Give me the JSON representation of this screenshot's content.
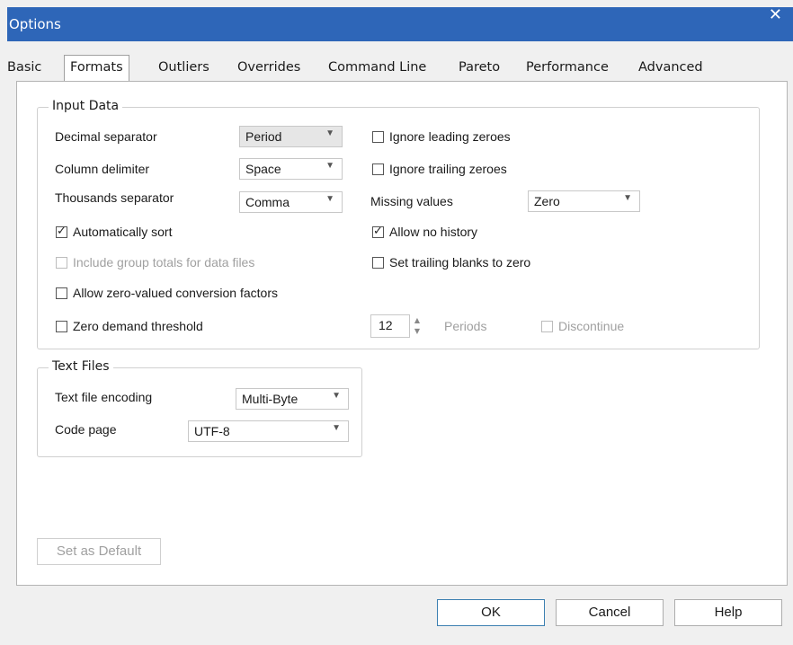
{
  "window": {
    "title": "Options",
    "close_glyph": "✕"
  },
  "tabs": [
    "Basic",
    "Formats",
    "Outliers",
    "Overrides",
    "Command Line",
    "Pareto",
    "Performance",
    "Advanced"
  ],
  "active_tab": "Formats",
  "input_data": {
    "legend": "Input Data",
    "decimal_separator": {
      "label": "Decimal separator",
      "value": "Period"
    },
    "column_delimiter": {
      "label": "Column delimiter",
      "value": "Space"
    },
    "thousands_separator": {
      "label": "Thousands separator",
      "value": "Comma"
    },
    "auto_sort": {
      "label": "Automatically sort",
      "checked": true
    },
    "include_group_totals": {
      "label": "Include group totals for data files",
      "checked": false,
      "disabled": true
    },
    "allow_zero_conversion": {
      "label": "Allow zero-valued conversion factors",
      "checked": false
    },
    "zero_demand": {
      "label": "Zero demand threshold",
      "checked": false
    },
    "ignore_leading": {
      "label": "Ignore leading zeroes",
      "checked": false
    },
    "ignore_trailing": {
      "label": "Ignore trailing zeroes",
      "checked": false
    },
    "missing_values": {
      "label": "Missing values",
      "value": "Zero"
    },
    "allow_no_history": {
      "label": "Allow no history",
      "checked": true
    },
    "set_trailing_blanks": {
      "label": "Set trailing blanks to zero",
      "checked": false
    },
    "periods": {
      "value": "12",
      "label": "Periods"
    },
    "discontinue": {
      "label": "Discontinue",
      "checked": false,
      "disabled": true
    }
  },
  "text_files": {
    "legend": "Text Files",
    "encoding": {
      "label": "Text file encoding",
      "value": "Multi-Byte"
    },
    "code_page": {
      "label": "Code page",
      "value": "UTF-8"
    }
  },
  "buttons": {
    "set_default": "Set as Default",
    "ok": "OK",
    "cancel": "Cancel",
    "help": "Help"
  }
}
